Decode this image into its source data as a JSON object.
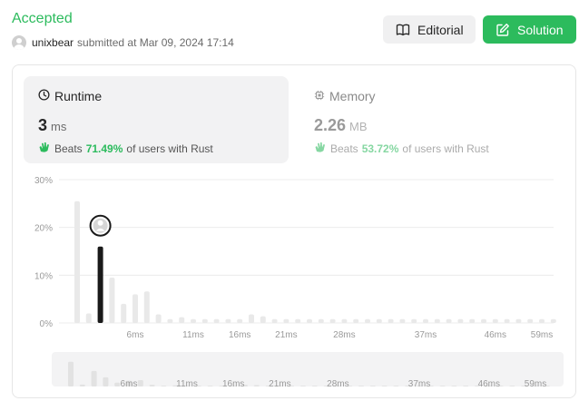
{
  "header": {
    "status": "Accepted",
    "username": "unixbear",
    "submitted_text": "submitted at Mar 09, 2024 17:14",
    "editorial_label": "Editorial",
    "solution_label": "Solution"
  },
  "runtime": {
    "title": "Runtime",
    "value": "3",
    "unit": "ms",
    "beats_label": "Beats",
    "beats_pct": "71.49%",
    "beats_suffix": "of users with Rust"
  },
  "memory": {
    "title": "Memory",
    "value": "2.26",
    "unit": "MB",
    "beats_label": "Beats",
    "beats_pct": "53.72%",
    "beats_suffix": "of users with Rust"
  },
  "colors": {
    "accent_green": "#2cbb5d",
    "bar_default": "#e9e9e9",
    "bar_highlight": "#1a1a1a"
  },
  "chart_data": {
    "type": "bar",
    "ylim": [
      0,
      30
    ],
    "yticks": [
      "0%",
      "10%",
      "20%",
      "30%"
    ],
    "xtick_labels": [
      "6ms",
      "11ms",
      "16ms",
      "21ms",
      "28ms",
      "37ms",
      "46ms",
      "59ms"
    ],
    "highlight_index": 2,
    "values": [
      25.5,
      2,
      16,
      9.5,
      4,
      6,
      6.6,
      1.8,
      0.8,
      1.2,
      0.8,
      0.8,
      0.8,
      0.8,
      0.8,
      1.8,
      1.4,
      0.8,
      0.8,
      0.8,
      0.8,
      0.8,
      0.8,
      0.8,
      0.8,
      0.8,
      0.8,
      0.8,
      0.8,
      0.8,
      0.8,
      0.8,
      0.8,
      0.8,
      0.8,
      0.8,
      0.8,
      0.8,
      0.8,
      0.8,
      0.8,
      0.8
    ]
  }
}
